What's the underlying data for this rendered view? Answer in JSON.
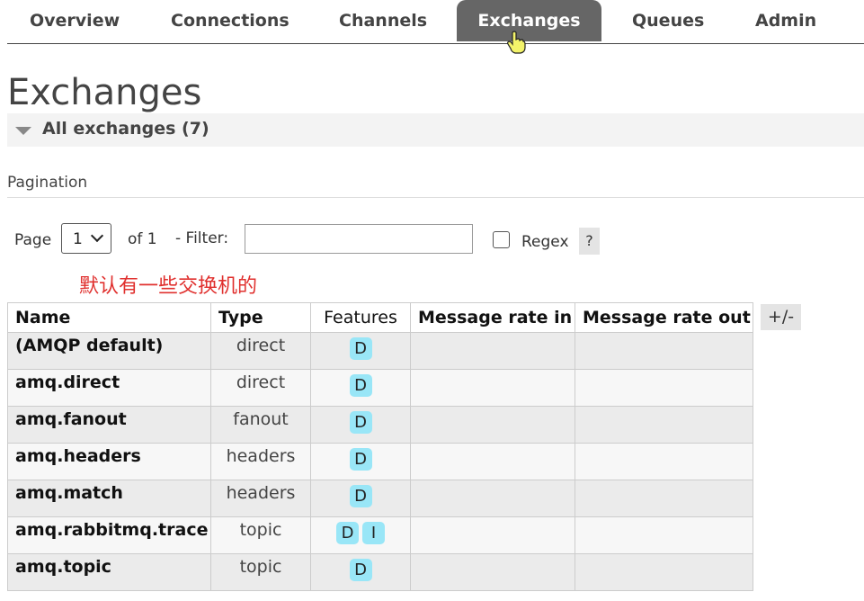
{
  "nav": {
    "tabs": [
      {
        "label": "Overview"
      },
      {
        "label": "Connections"
      },
      {
        "label": "Channels"
      },
      {
        "label": "Exchanges",
        "active": true
      },
      {
        "label": "Queues"
      },
      {
        "label": "Admin"
      }
    ],
    "active_color": "#666666"
  },
  "page": {
    "title": "Exchanges"
  },
  "section": {
    "title": "All exchanges (7)"
  },
  "pagination": {
    "label": "Pagination",
    "page_label": "Page",
    "page_value": "1",
    "of_label": "of 1",
    "filter_label": "- Filter:",
    "filter_value": "",
    "regex_label": "Regex",
    "regex_checked": false,
    "help_label": "?"
  },
  "annotation": {
    "text": "默认有一些交换机的",
    "color": "#e0302e"
  },
  "table": {
    "columns": [
      "Name",
      "Type",
      "Features",
      "Message rate in",
      "Message rate out"
    ],
    "column_toggle_label": "+/-",
    "badge_color": "#99e6f7",
    "rows": [
      {
        "name": "(AMQP default)",
        "type": "direct",
        "features": [
          "D"
        ],
        "rate_in": "",
        "rate_out": ""
      },
      {
        "name": "amq.direct",
        "type": "direct",
        "features": [
          "D"
        ],
        "rate_in": "",
        "rate_out": ""
      },
      {
        "name": "amq.fanout",
        "type": "fanout",
        "features": [
          "D"
        ],
        "rate_in": "",
        "rate_out": ""
      },
      {
        "name": "amq.headers",
        "type": "headers",
        "features": [
          "D"
        ],
        "rate_in": "",
        "rate_out": ""
      },
      {
        "name": "amq.match",
        "type": "headers",
        "features": [
          "D"
        ],
        "rate_in": "",
        "rate_out": ""
      },
      {
        "name": "amq.rabbitmq.trace",
        "type": "topic",
        "features": [
          "D",
          "I"
        ],
        "rate_in": "",
        "rate_out": ""
      },
      {
        "name": "amq.topic",
        "type": "topic",
        "features": [
          "D"
        ],
        "rate_in": "",
        "rate_out": ""
      }
    ]
  }
}
